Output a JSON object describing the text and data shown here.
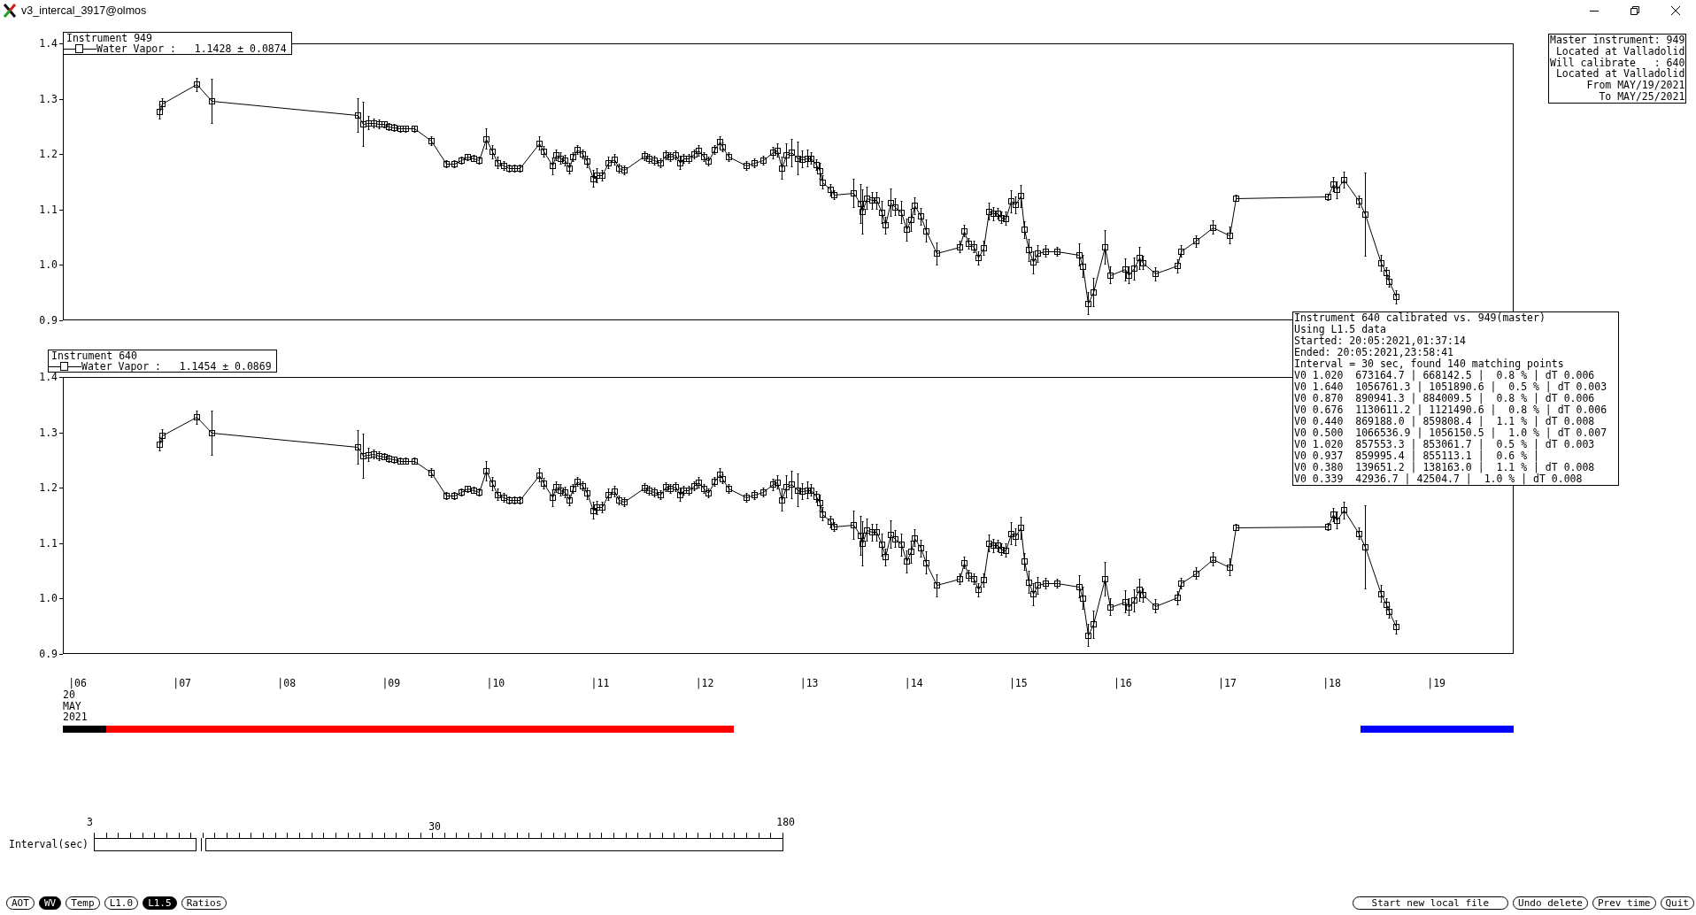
{
  "window": {
    "title": "v3_intercal_3917@olmos"
  },
  "plots": [
    {
      "legend": {
        "entry": "Water Vapor :   1.1428 ± 0.0874"
      },
      "chart_data": {
        "type": "line",
        "title": "Instrument 949",
        "xlim": [
          5.91,
          19.79
        ],
        "ylim": [
          0.9,
          1.4
        ],
        "yticks": [
          {
            "value": 0.9,
            "label": "0.9"
          },
          {
            "value": 1.0,
            "label": "1.0"
          },
          {
            "value": 1.1,
            "label": "1.1"
          },
          {
            "value": 1.2,
            "label": "1.2"
          },
          {
            "value": 1.3,
            "label": "1.3"
          },
          {
            "value": 1.4,
            "label": "1.4"
          }
        ],
        "x": [
          6.83,
          6.86,
          7.19,
          7.33,
          8.73,
          8.78,
          8.83,
          8.88,
          8.93,
          8.98,
          9.03,
          9.08,
          9.14,
          9.19,
          9.27,
          9.43,
          9.58,
          9.65,
          9.72,
          9.78,
          9.84,
          9.89,
          9.96,
          10.02,
          10.07,
          10.13,
          10.18,
          10.23,
          10.28,
          10.47,
          10.51,
          10.59,
          10.63,
          10.67,
          10.71,
          10.75,
          10.79,
          10.83,
          10.88,
          10.92,
          10.98,
          11.02,
          11.07,
          11.13,
          11.19,
          11.23,
          11.28,
          11.47,
          11.52,
          11.57,
          11.63,
          11.68,
          11.72,
          11.77,
          11.81,
          11.85,
          11.9,
          11.95,
          11.99,
          12.04,
          12.08,
          12.14,
          12.19,
          12.22,
          12.28,
          12.45,
          12.52,
          12.61,
          12.7,
          12.74,
          12.79,
          12.83,
          12.88,
          12.94,
          12.98,
          13.03,
          13.07,
          13.12,
          13.15,
          13.18,
          13.25,
          13.29,
          13.47,
          13.54,
          13.56,
          13.6,
          13.65,
          13.69,
          13.74,
          13.78,
          13.83,
          13.87,
          13.93,
          13.98,
          14.02,
          14.06,
          14.12,
          14.17,
          14.27,
          14.49,
          14.53,
          14.57,
          14.62,
          14.67,
          14.72,
          14.77,
          14.81,
          14.85,
          14.89,
          14.93,
          14.98,
          15.02,
          15.07,
          15.11,
          15.15,
          15.19,
          15.23,
          15.31,
          15.42,
          15.63,
          15.67,
          15.72,
          15.77,
          15.88,
          15.93,
          16.07,
          16.11,
          16.16,
          16.21,
          16.24,
          16.36,
          16.57,
          16.61,
          16.75,
          16.91,
          17.07,
          17.13,
          18.01,
          18.06,
          18.1,
          18.16,
          18.31,
          18.37,
          18.52,
          18.57,
          18.6,
          18.66
        ],
        "series": [
          {
            "color": "#000000",
            "marker": "square",
            "values": [
              1.277,
              1.291,
              1.326,
              1.296,
              1.271,
              1.255,
              1.257,
              1.257,
              1.255,
              1.254,
              1.25,
              1.248,
              1.246,
              1.246,
              1.246,
              1.224,
              1.183,
              1.183,
              1.189,
              1.195,
              1.193,
              1.189,
              1.228,
              1.205,
              1.185,
              1.179,
              1.175,
              1.175,
              1.175,
              1.22,
              1.205,
              1.179,
              1.199,
              1.193,
              1.189,
              1.175,
              1.195,
              1.209,
              1.201,
              1.187,
              1.156,
              1.162,
              1.162,
              1.185,
              1.191,
              1.175,
              1.171,
              1.197,
              1.193,
              1.189,
              1.185,
              1.199,
              1.195,
              1.199,
              1.185,
              1.193,
              1.193,
              1.201,
              1.207,
              1.195,
              1.187,
              1.209,
              1.222,
              1.213,
              1.195,
              1.179,
              1.185,
              1.189,
              1.203,
              1.207,
              1.175,
              1.199,
              1.203,
              1.193,
              1.191,
              1.193,
              1.193,
              1.181,
              1.17,
              1.15,
              1.136,
              1.127,
              1.13,
              1.111,
              1.097,
              1.121,
              1.117,
              1.117,
              1.095,
              1.072,
              1.113,
              1.105,
              1.095,
              1.064,
              1.082,
              1.107,
              1.088,
              1.062,
              1.021,
              1.033,
              1.062,
              1.039,
              1.033,
              1.013,
              1.031,
              1.097,
              1.093,
              1.093,
              1.086,
              1.084,
              1.115,
              1.109,
              1.125,
              1.064,
              1.027,
              1.005,
              1.021,
              1.025,
              1.025,
              1.019,
              0.998,
              0.931,
              0.951,
              1.033,
              0.982,
              0.992,
              0.982,
              0.994,
              1.013,
              1.004,
              0.984,
              0.999,
              1.025,
              1.043,
              1.068,
              1.054,
              1.121,
              1.123,
              1.146,
              1.136,
              1.154,
              1.115,
              1.091,
              1.004,
              0.986,
              0.97,
              0.943
            ],
            "errors": [
              0.012,
              0.01,
              0.012,
              0.04,
              0.03,
              0.04,
              0.012,
              0.008,
              0.008,
              0.006,
              0.006,
              0.006,
              0.006,
              0.006,
              0.006,
              0.008,
              0.006,
              0.006,
              0.006,
              0.006,
              0.006,
              0.006,
              0.018,
              0.012,
              0.01,
              0.008,
              0.006,
              0.006,
              0.006,
              0.012,
              0.01,
              0.015,
              0.01,
              0.01,
              0.01,
              0.01,
              0.008,
              0.008,
              0.008,
              0.01,
              0.015,
              0.012,
              0.01,
              0.01,
              0.01,
              0.008,
              0.008,
              0.008,
              0.008,
              0.008,
              0.008,
              0.008,
              0.008,
              0.008,
              0.012,
              0.008,
              0.008,
              0.008,
              0.01,
              0.008,
              0.008,
              0.008,
              0.01,
              0.008,
              0.008,
              0.008,
              0.008,
              0.008,
              0.01,
              0.012,
              0.02,
              0.02,
              0.025,
              0.03,
              0.015,
              0.015,
              0.01,
              0.01,
              0.015,
              0.012,
              0.01,
              0.008,
              0.025,
              0.035,
              0.04,
              0.02,
              0.015,
              0.015,
              0.02,
              0.015,
              0.025,
              0.015,
              0.02,
              0.02,
              0.02,
              0.015,
              0.015,
              0.02,
              0.02,
              0.01,
              0.01,
              0.01,
              0.01,
              0.012,
              0.012,
              0.015,
              0.012,
              0.01,
              0.01,
              0.012,
              0.02,
              0.015,
              0.02,
              0.015,
              0.02,
              0.02,
              0.015,
              0.01,
              0.008,
              0.02,
              0.02,
              0.02,
              0.025,
              0.03,
              0.015,
              0.02,
              0.015,
              0.02,
              0.02,
              0.012,
              0.012,
              0.012,
              0.01,
              0.01,
              0.012,
              0.015,
              0.006,
              0.006,
              0.012,
              0.015,
              0.015,
              0.01,
              0.075,
              0.015,
              0.01,
              0.01,
              0.012
            ]
          }
        ]
      }
    },
    {
      "legend": {
        "entry": "Water Vapor :   1.1454 ± 0.0869"
      },
      "chart_data": {
        "type": "line",
        "title": "Instrument 640",
        "xlim": [
          5.91,
          19.79
        ],
        "ylim": [
          0.9,
          1.4
        ],
        "xticks": [
          {
            "value": 6.05,
            "label": "|06"
          },
          {
            "value": 7.05,
            "label": "|07"
          },
          {
            "value": 8.05,
            "label": "|08"
          },
          {
            "value": 9.05,
            "label": "|09"
          },
          {
            "value": 10.05,
            "label": "|10"
          },
          {
            "value": 11.05,
            "label": "|11"
          },
          {
            "value": 12.05,
            "label": "|12"
          },
          {
            "value": 13.05,
            "label": "|13"
          },
          {
            "value": 14.05,
            "label": "|14"
          },
          {
            "value": 15.05,
            "label": "|15"
          },
          {
            "value": 16.05,
            "label": "|16"
          },
          {
            "value": 17.05,
            "label": "|17"
          },
          {
            "value": 18.05,
            "label": "|18"
          },
          {
            "value": 19.05,
            "label": "|19"
          }
        ],
        "yticks": [
          {
            "value": 0.9,
            "label": "0.9"
          },
          {
            "value": 1.0,
            "label": "1.0"
          },
          {
            "value": 1.1,
            "label": "1.1"
          },
          {
            "value": 1.2,
            "label": "1.2"
          },
          {
            "value": 1.3,
            "label": "1.3"
          },
          {
            "value": 1.4,
            "label": "1.4"
          }
        ],
        "x": [
          6.83,
          6.86,
          7.19,
          7.33,
          8.73,
          8.78,
          8.83,
          8.88,
          8.93,
          8.98,
          9.03,
          9.08,
          9.14,
          9.19,
          9.27,
          9.43,
          9.58,
          9.65,
          9.72,
          9.78,
          9.84,
          9.89,
          9.96,
          10.02,
          10.07,
          10.13,
          10.18,
          10.23,
          10.28,
          10.47,
          10.51,
          10.59,
          10.63,
          10.67,
          10.71,
          10.75,
          10.79,
          10.83,
          10.88,
          10.92,
          10.98,
          11.02,
          11.07,
          11.13,
          11.19,
          11.23,
          11.28,
          11.47,
          11.52,
          11.57,
          11.63,
          11.68,
          11.72,
          11.77,
          11.81,
          11.85,
          11.9,
          11.95,
          11.99,
          12.04,
          12.08,
          12.14,
          12.19,
          12.22,
          12.28,
          12.45,
          12.52,
          12.61,
          12.7,
          12.74,
          12.79,
          12.83,
          12.88,
          12.94,
          12.98,
          13.03,
          13.07,
          13.12,
          13.15,
          13.18,
          13.25,
          13.29,
          13.47,
          13.54,
          13.56,
          13.6,
          13.65,
          13.69,
          13.74,
          13.78,
          13.83,
          13.87,
          13.93,
          13.98,
          14.02,
          14.06,
          14.12,
          14.17,
          14.27,
          14.49,
          14.53,
          14.57,
          14.62,
          14.67,
          14.72,
          14.77,
          14.81,
          14.85,
          14.89,
          14.93,
          14.98,
          15.02,
          15.07,
          15.11,
          15.15,
          15.19,
          15.23,
          15.31,
          15.42,
          15.63,
          15.67,
          15.72,
          15.77,
          15.88,
          15.93,
          16.07,
          16.11,
          16.16,
          16.21,
          16.24,
          16.36,
          16.57,
          16.61,
          16.75,
          16.91,
          17.07,
          17.13,
          18.01,
          18.06,
          18.1,
          18.16,
          18.31,
          18.37,
          18.52,
          18.57,
          18.6,
          18.66
        ],
        "series": [
          {
            "color": "#000000",
            "marker": "square",
            "values": [
              1.279,
              1.295,
              1.328,
              1.3,
              1.274,
              1.258,
              1.26,
              1.261,
              1.258,
              1.257,
              1.253,
              1.251,
              1.249,
              1.249,
              1.249,
              1.227,
              1.186,
              1.186,
              1.192,
              1.198,
              1.196,
              1.192,
              1.231,
              1.208,
              1.188,
              1.182,
              1.178,
              1.178,
              1.178,
              1.223,
              1.208,
              1.182,
              1.202,
              1.196,
              1.192,
              1.178,
              1.198,
              1.212,
              1.204,
              1.19,
              1.159,
              1.165,
              1.165,
              1.188,
              1.194,
              1.178,
              1.174,
              1.2,
              1.196,
              1.192,
              1.188,
              1.202,
              1.198,
              1.202,
              1.188,
              1.196,
              1.196,
              1.204,
              1.21,
              1.198,
              1.19,
              1.212,
              1.225,
              1.216,
              1.198,
              1.182,
              1.188,
              1.192,
              1.206,
              1.21,
              1.178,
              1.202,
              1.206,
              1.196,
              1.194,
              1.196,
              1.196,
              1.184,
              1.173,
              1.153,
              1.139,
              1.13,
              1.133,
              1.114,
              1.1,
              1.124,
              1.12,
              1.12,
              1.098,
              1.075,
              1.116,
              1.108,
              1.098,
              1.067,
              1.085,
              1.11,
              1.091,
              1.065,
              1.024,
              1.036,
              1.065,
              1.042,
              1.036,
              1.016,
              1.034,
              1.1,
              1.096,
              1.096,
              1.089,
              1.087,
              1.118,
              1.112,
              1.128,
              1.067,
              1.03,
              1.008,
              1.024,
              1.028,
              1.028,
              1.022,
              1.001,
              0.934,
              0.954,
              1.036,
              0.985,
              0.995,
              0.985,
              0.997,
              1.016,
              1.007,
              0.987,
              1.002,
              1.028,
              1.046,
              1.071,
              1.057,
              1.129,
              1.13,
              1.152,
              1.142,
              1.16,
              1.118,
              1.094,
              1.009,
              0.99,
              0.976,
              0.949
            ],
            "errors": [
              0.012,
              0.01,
              0.012,
              0.04,
              0.03,
              0.04,
              0.012,
              0.008,
              0.008,
              0.006,
              0.006,
              0.006,
              0.006,
              0.006,
              0.006,
              0.008,
              0.006,
              0.006,
              0.006,
              0.006,
              0.006,
              0.006,
              0.018,
              0.012,
              0.01,
              0.008,
              0.006,
              0.006,
              0.006,
              0.012,
              0.01,
              0.015,
              0.01,
              0.01,
              0.01,
              0.01,
              0.008,
              0.008,
              0.008,
              0.01,
              0.015,
              0.012,
              0.01,
              0.01,
              0.01,
              0.008,
              0.008,
              0.008,
              0.008,
              0.008,
              0.008,
              0.008,
              0.008,
              0.008,
              0.012,
              0.008,
              0.008,
              0.008,
              0.01,
              0.008,
              0.008,
              0.008,
              0.01,
              0.008,
              0.008,
              0.008,
              0.008,
              0.008,
              0.01,
              0.012,
              0.02,
              0.02,
              0.025,
              0.03,
              0.015,
              0.015,
              0.01,
              0.01,
              0.015,
              0.012,
              0.01,
              0.008,
              0.025,
              0.035,
              0.04,
              0.02,
              0.015,
              0.015,
              0.02,
              0.015,
              0.025,
              0.015,
              0.02,
              0.02,
              0.02,
              0.015,
              0.015,
              0.02,
              0.02,
              0.01,
              0.01,
              0.01,
              0.01,
              0.012,
              0.012,
              0.015,
              0.012,
              0.01,
              0.01,
              0.012,
              0.02,
              0.015,
              0.02,
              0.015,
              0.02,
              0.02,
              0.015,
              0.01,
              0.008,
              0.02,
              0.02,
              0.02,
              0.025,
              0.03,
              0.015,
              0.02,
              0.015,
              0.02,
              0.02,
              0.012,
              0.012,
              0.012,
              0.01,
              0.01,
              0.012,
              0.015,
              0.006,
              0.006,
              0.012,
              0.015,
              0.015,
              0.01,
              0.075,
              0.015,
              0.01,
              0.01,
              0.012
            ]
          }
        ]
      }
    }
  ],
  "master_info": {
    "lines": [
      "Master instrument: 949",
      "Located at Valladolid",
      "Will calibrate   : 640",
      "Located at Valladolid",
      "From MAY/19/2021",
      "To MAY/25/2021"
    ]
  },
  "calibration_report": {
    "lines": [
      "Instrument 640 calibrated vs. 949(master)",
      "Using L1.5 data",
      "Started: 20:05:2021,01:37:14",
      "Ended: 20:05:2021,23:58:41",
      "Interval = 30 sec, found 140 matching points",
      "V0 1.020  673164.7 | 668142.5 |  0.8 % | dT 0.006",
      "V0 1.640  1056761.3 | 1051890.6 |  0.5 % | dT 0.003",
      "V0 0.870  890941.3 | 884009.5 |  0.8 % | dT 0.006",
      "V0 0.676  1130611.2 | 1121490.6 |  0.8 % | dT 0.006",
      "V0 0.440  869188.0 | 859808.4 |  1.1 % | dT 0.008",
      "V0 0.500  1066536.9 | 1056150.5 |  1.0 % | dT 0.007",
      "V0 1.020  857553.3 | 853061.7 |  0.5 % | dT 0.003",
      "V0 0.937  859995.4 | 855113.1 |  0.6 % |",
      "V0 0.380  139651.2 | 138163.0 |  1.1 % | dT 0.008",
      "V0 0.339  42936.7 | 42504.7 |  1.0 % | dT 0.008"
    ]
  },
  "date_label": {
    "lines": [
      "20",
      "MAY",
      "2021"
    ]
  },
  "time_strip": {
    "segments": [
      {
        "color": "#000000"
      },
      {
        "color": "#ff0000"
      },
      {
        "color": "#0000ff"
      }
    ]
  },
  "slider": {
    "label": "Interval(sec)",
    "scale_labels": [
      "3",
      "30",
      "180"
    ],
    "level": 0.155
  },
  "product_buttons": [
    {
      "label": "AOT",
      "selected": false
    },
    {
      "label": "WV",
      "selected": true
    },
    {
      "label": "Temp",
      "selected": false
    },
    {
      "label": "L1.0",
      "selected": false
    },
    {
      "label": "L1.5",
      "selected": true
    },
    {
      "label": "Ratios",
      "selected": false
    }
  ],
  "action_buttons": [
    "Start new local file",
    "Undo delete",
    "Prev time",
    "Quit"
  ]
}
